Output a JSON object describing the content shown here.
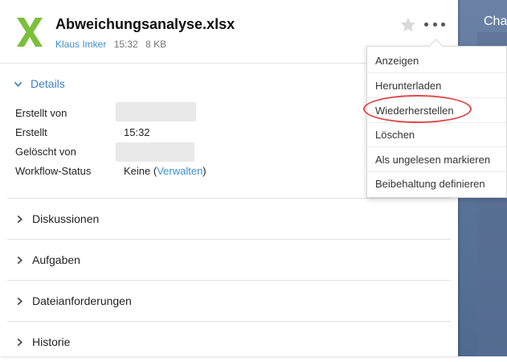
{
  "background": {
    "text": "Cha"
  },
  "file": {
    "icon": "excel-x-icon",
    "icon_color": "#7bbf3a",
    "title": "Abweichungsanalyse.xlsx",
    "owner": "Klaus Imker",
    "time": "15:32",
    "size": "8 KB"
  },
  "toolbar": {
    "star_icon": "star-icon",
    "more_icon": "more-dots-icon"
  },
  "details": {
    "label": "Details",
    "rows": [
      {
        "label": "Erstellt von",
        "value": ""
      },
      {
        "label": "Erstellt",
        "value": "15:32"
      },
      {
        "label": "Gelöscht von",
        "value": ""
      },
      {
        "label": "Workflow-Status",
        "value_prefix": "Keine (",
        "value_link": "Verwalten",
        "value_suffix": ")"
      }
    ]
  },
  "sections": [
    {
      "label": "Diskussionen"
    },
    {
      "label": "Aufgaben"
    },
    {
      "label": "Dateianforderungen"
    },
    {
      "label": "Historie"
    }
  ],
  "menu": {
    "items": [
      {
        "label": "Anzeigen"
      },
      {
        "label": "Herunterladen"
      },
      {
        "label": "Wiederherstellen"
      },
      {
        "label": "Löschen"
      },
      {
        "label": "Als ungelesen markieren"
      },
      {
        "label": "Beibehaltung definieren"
      }
    ]
  },
  "colors": {
    "accent": "#3d8fd0",
    "highlight": "#e04848"
  }
}
